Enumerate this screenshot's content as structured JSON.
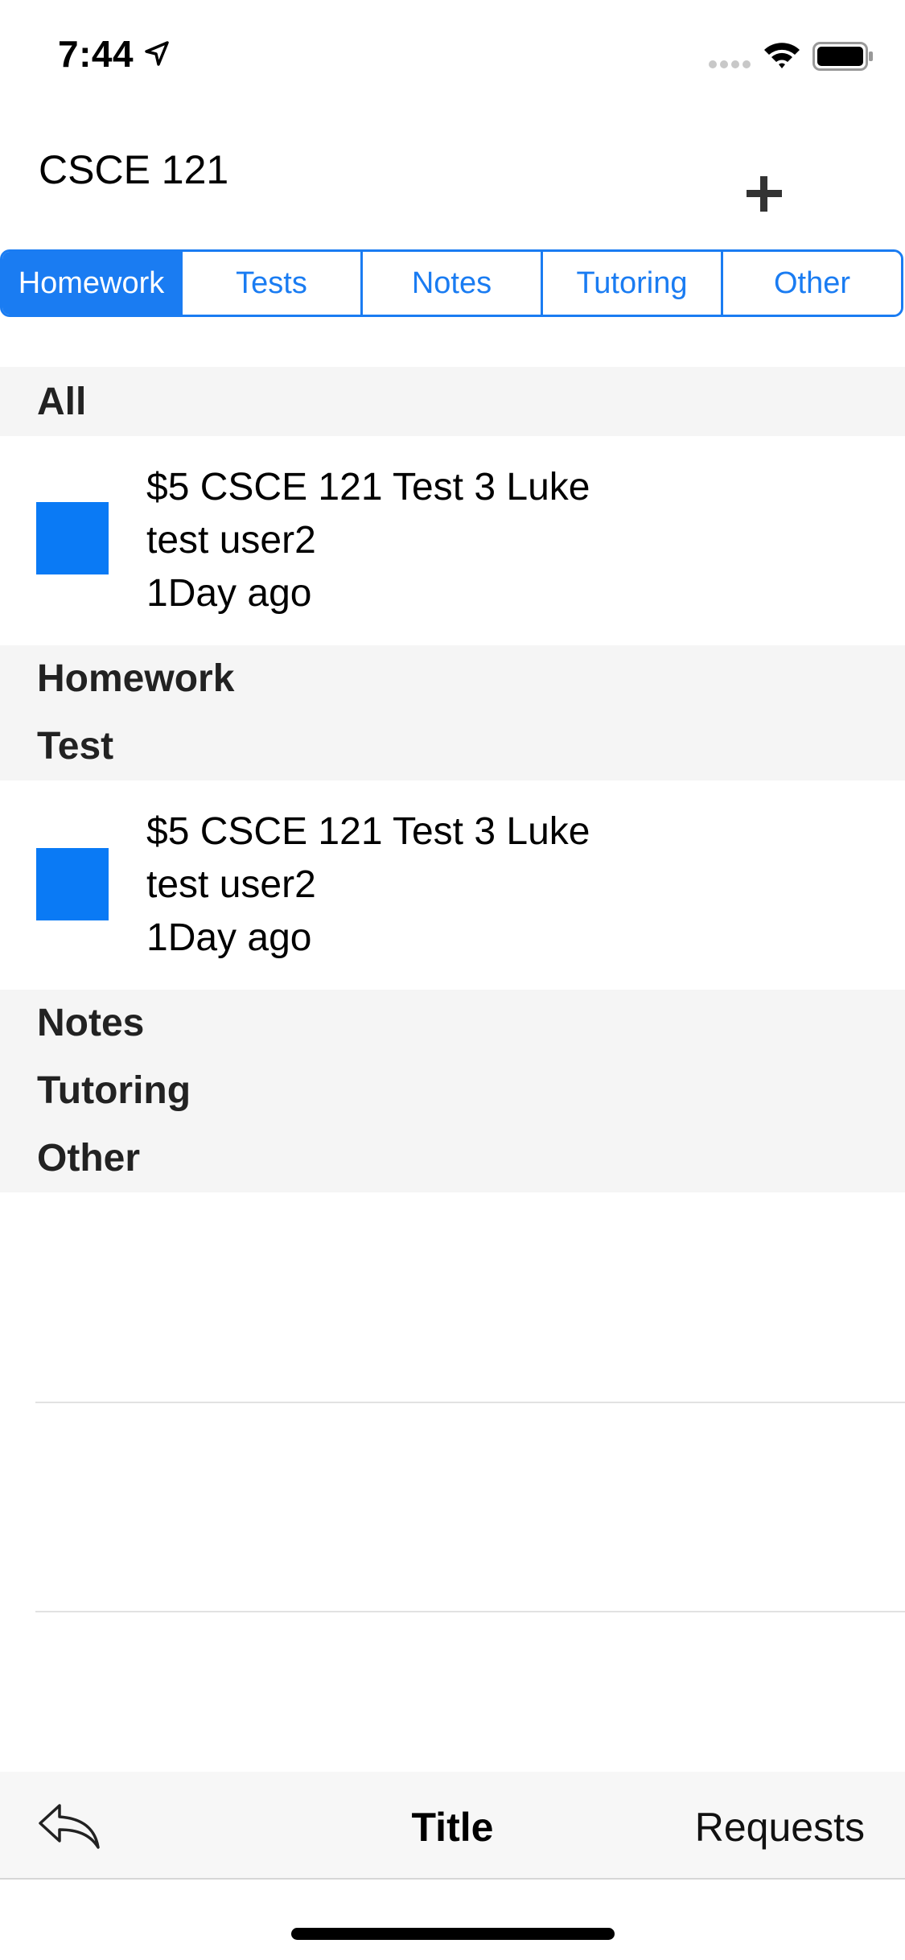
{
  "status_bar": {
    "time": "7:44"
  },
  "header": {
    "title": "CSCE 121",
    "add_icon": "plus-icon"
  },
  "segments": [
    {
      "label": "Homework",
      "selected": true
    },
    {
      "label": "Tests",
      "selected": false
    },
    {
      "label": "Notes",
      "selected": false
    },
    {
      "label": "Tutoring",
      "selected": false
    },
    {
      "label": "Other",
      "selected": false
    }
  ],
  "sections": {
    "all": "All",
    "homework": "Homework",
    "test": "Test",
    "notes": "Notes",
    "tutoring": "Tutoring",
    "other": "Other"
  },
  "rows": [
    {
      "title": " $5 CSCE 121 Test 3 Luke",
      "user": "test user2",
      "time": " 1Day ago"
    },
    {
      "title": " $5 CSCE 121 Test 3 Luke",
      "user": "test user2",
      "time": " 1Day ago"
    }
  ],
  "bottom_bar": {
    "title": "Title",
    "requests_label": "Requests",
    "back_icon": "reply-icon"
  },
  "colors": {
    "accent": "#1a7cf2",
    "thumbnail": "#0a7af5",
    "section_background": "#f5f5f5"
  }
}
